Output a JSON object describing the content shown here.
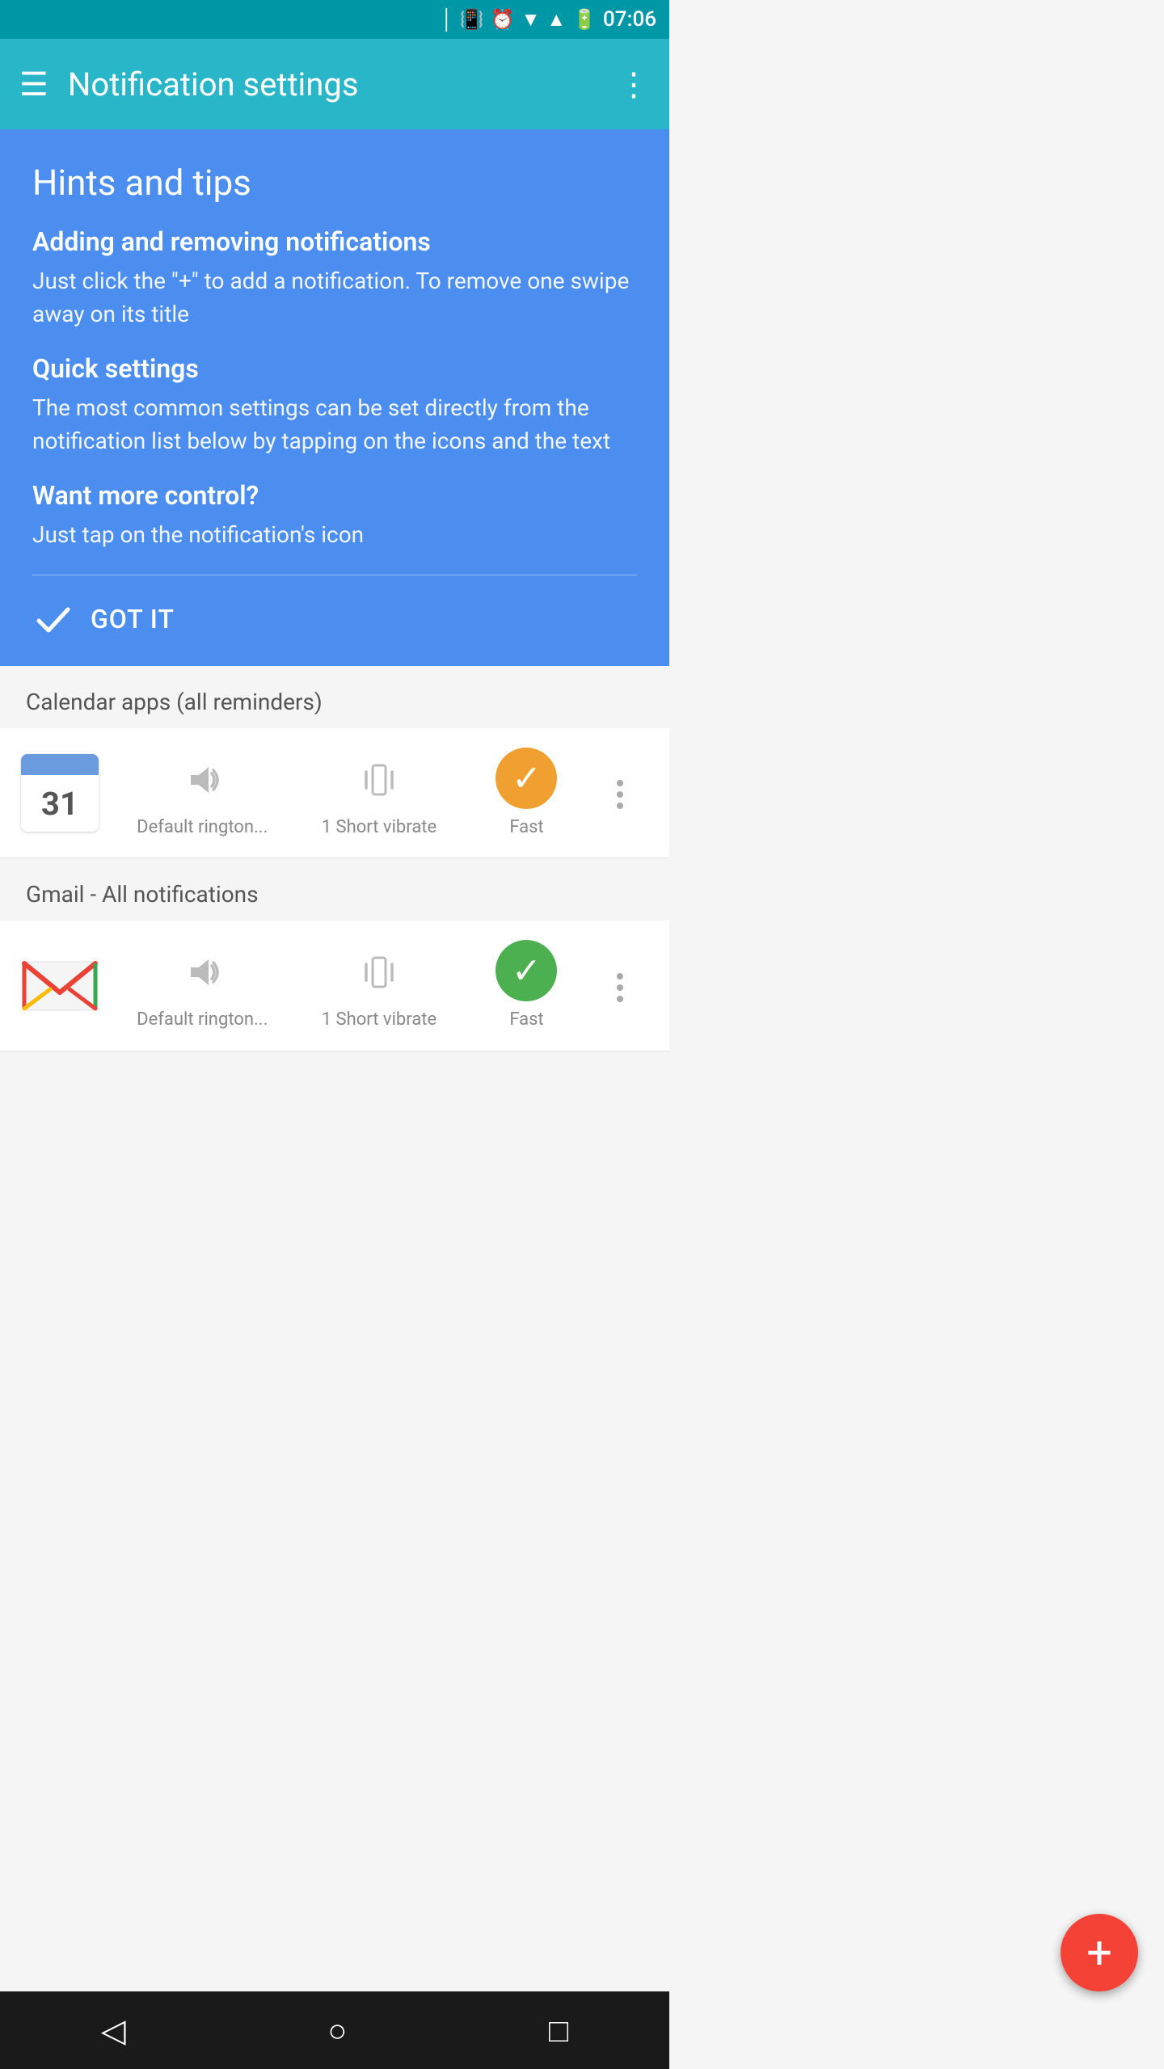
{
  "statusBar": {
    "time": "07:06"
  },
  "toolbar": {
    "menuIcon": "☰",
    "title": "Notification settings",
    "moreIcon": "⋮"
  },
  "hintsCard": {
    "title": "Hints and tips",
    "sections": [
      {
        "heading": "Adding and removing notifications",
        "body": "Just click the \"+\" to add a notification. To remove one swipe away on its title"
      },
      {
        "heading": "Quick settings",
        "body": "The most common settings can be set directly from the notification list below by tapping on the icons and the text"
      },
      {
        "heading": "Want more control?",
        "body": "Just tap on the notification's icon"
      }
    ],
    "gotItLabel": "GOT IT"
  },
  "calendarSection": {
    "header": "Calendar apps (all reminders)",
    "appIconDay": "31",
    "controls": [
      {
        "label": "Default rington...",
        "type": "sound"
      },
      {
        "label": "1 Short vibrate",
        "type": "vibrate"
      },
      {
        "label": "Fast",
        "type": "check-orange"
      }
    ]
  },
  "gmailSection": {
    "header": "Gmail - All notifications",
    "controls": [
      {
        "label": "Default rington...",
        "type": "sound"
      },
      {
        "label": "1 Short vibrate",
        "type": "vibrate"
      },
      {
        "label": "Fast",
        "type": "check-green"
      }
    ]
  },
  "fab": {
    "label": "+"
  },
  "bottomNav": {
    "back": "◁",
    "home": "○",
    "recent": "□"
  }
}
